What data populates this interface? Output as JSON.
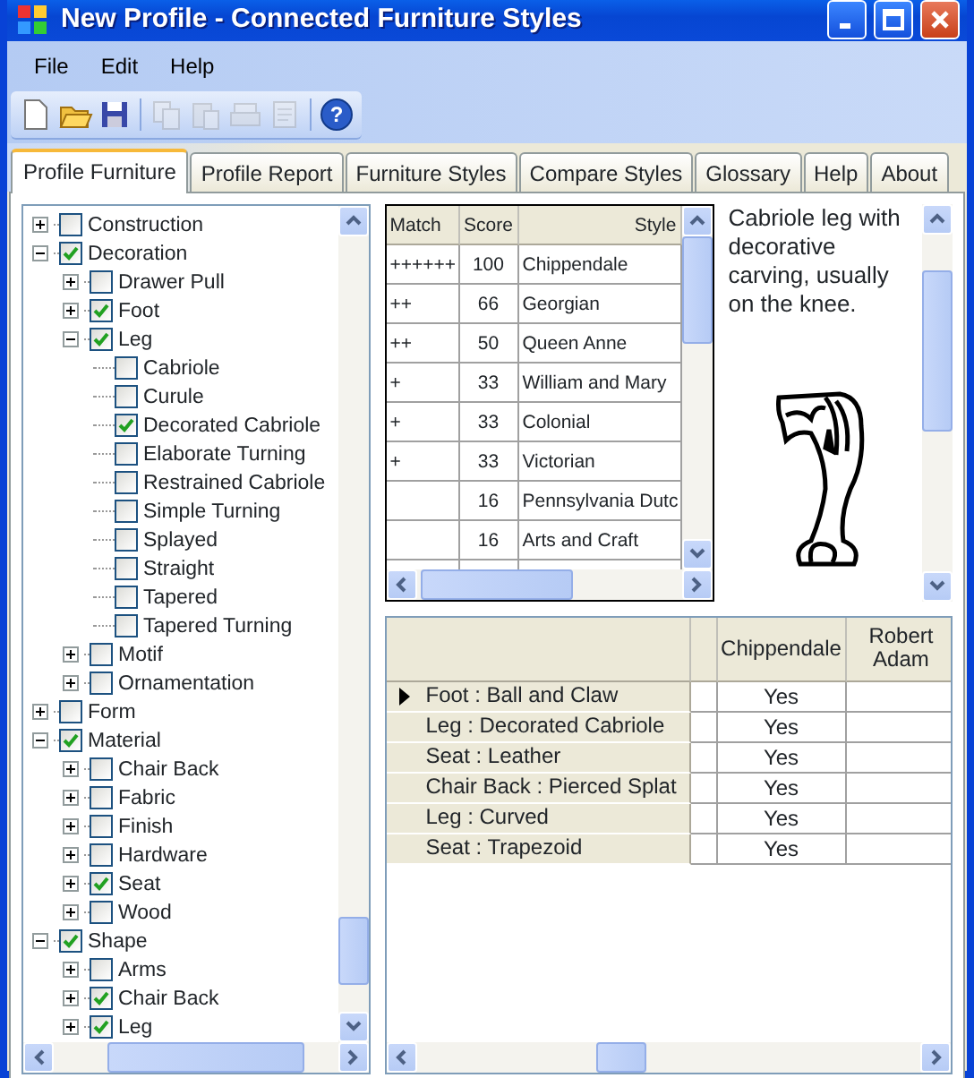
{
  "window": {
    "title": "New Profile - Connected Furniture Styles"
  },
  "menu": [
    "File",
    "Edit",
    "Help"
  ],
  "toolbar": [
    {
      "kind": "button",
      "disabled": false
    },
    {
      "kind": "button",
      "disabled": false
    },
    {
      "kind": "button",
      "disabled": false
    },
    {
      "kind": "separator"
    },
    {
      "kind": "button",
      "disabled": true
    },
    {
      "kind": "button",
      "disabled": true
    },
    {
      "kind": "button",
      "disabled": true
    },
    {
      "kind": "button",
      "disabled": true
    },
    {
      "kind": "separator"
    },
    {
      "kind": "button",
      "disabled": false,
      "label": "?"
    }
  ],
  "tabs": [
    {
      "label": "Profile Furniture",
      "selected": true
    },
    {
      "label": "Profile Report",
      "selected": false
    },
    {
      "label": "Furniture Styles",
      "selected": false
    },
    {
      "label": "Compare Styles",
      "selected": false
    },
    {
      "label": "Glossary",
      "selected": false
    },
    {
      "label": "Help",
      "selected": false
    },
    {
      "label": "About",
      "selected": false
    }
  ],
  "tree": [
    {
      "label": "Construction",
      "checked": false,
      "kind": "branch",
      "expanded": false
    },
    {
      "label": "Decoration",
      "checked": true,
      "kind": "branch",
      "expanded": true,
      "children": [
        {
          "label": "Drawer Pull",
          "checked": false,
          "kind": "branch",
          "expanded": false
        },
        {
          "label": "Foot",
          "checked": true,
          "kind": "branch",
          "expanded": false
        },
        {
          "label": "Leg",
          "checked": true,
          "kind": "branch",
          "expanded": true,
          "children": [
            {
              "label": "Cabriole",
              "checked": false,
              "kind": "leaf"
            },
            {
              "label": "Curule",
              "checked": false,
              "kind": "leaf"
            },
            {
              "label": "Decorated Cabriole",
              "checked": true,
              "kind": "leaf"
            },
            {
              "label": "Elaborate Turning",
              "checked": false,
              "kind": "leaf"
            },
            {
              "label": "Restrained Cabriole",
              "checked": false,
              "kind": "leaf"
            },
            {
              "label": "Simple Turning",
              "checked": false,
              "kind": "leaf"
            },
            {
              "label": "Splayed",
              "checked": false,
              "kind": "leaf"
            },
            {
              "label": "Straight",
              "checked": false,
              "kind": "leaf"
            },
            {
              "label": "Tapered",
              "checked": false,
              "kind": "leaf"
            },
            {
              "label": "Tapered Turning",
              "checked": false,
              "kind": "leaf"
            }
          ]
        },
        {
          "label": "Motif",
          "checked": false,
          "kind": "branch",
          "expanded": false
        },
        {
          "label": "Ornamentation",
          "checked": false,
          "kind": "branch",
          "expanded": false
        }
      ]
    },
    {
      "label": "Form",
      "checked": false,
      "kind": "branch",
      "expanded": false
    },
    {
      "label": "Material",
      "checked": true,
      "kind": "branch",
      "expanded": true,
      "children": [
        {
          "label": "Chair Back",
          "checked": false,
          "kind": "branch",
          "expanded": false
        },
        {
          "label": "Fabric",
          "checked": false,
          "kind": "branch",
          "expanded": false
        },
        {
          "label": "Finish",
          "checked": false,
          "kind": "branch",
          "expanded": false
        },
        {
          "label": "Hardware",
          "checked": false,
          "kind": "branch",
          "expanded": false
        },
        {
          "label": "Seat",
          "checked": true,
          "kind": "branch",
          "expanded": false
        },
        {
          "label": "Wood",
          "checked": false,
          "kind": "branch",
          "expanded": false
        }
      ]
    },
    {
      "label": "Shape",
      "checked": true,
      "kind": "branch",
      "expanded": true,
      "children": [
        {
          "label": "Arms",
          "checked": false,
          "kind": "branch",
          "expanded": false
        },
        {
          "label": "Chair Back",
          "checked": true,
          "kind": "branch",
          "expanded": false
        },
        {
          "label": "Leg",
          "checked": true,
          "kind": "branch",
          "expanded": false
        }
      ]
    }
  ],
  "matches": {
    "columns": [
      "Match",
      "Score",
      "Style"
    ],
    "rows": [
      {
        "match": "++++++",
        "score": "100",
        "style": "Chippendale"
      },
      {
        "match": "++",
        "score": "66",
        "style": "Georgian"
      },
      {
        "match": "++",
        "score": "50",
        "style": "Queen Anne"
      },
      {
        "match": "+",
        "score": "33",
        "style": "William and Mary"
      },
      {
        "match": "+",
        "score": "33",
        "style": "Colonial"
      },
      {
        "match": "+",
        "score": "33",
        "style": "Victorian"
      },
      {
        "score": "16",
        "style": "Pennsylvania Dutc"
      },
      {
        "score": "16",
        "style": "Arts and Craft"
      }
    ]
  },
  "description": "Cabriole leg with decorative carving, usually on the knee.",
  "compare": {
    "columns": [
      "Chippendale",
      "Robert Adam"
    ],
    "rows": [
      {
        "label": "Foot : Ball and Claw",
        "selected": true,
        "values": [
          "Yes"
        ]
      },
      {
        "label": "Leg : Decorated Cabriole",
        "selected": false,
        "values": [
          "Yes"
        ]
      },
      {
        "label": "Seat : Leather",
        "selected": false,
        "values": [
          "Yes"
        ]
      },
      {
        "label": "Chair Back : Pierced Splat",
        "selected": false,
        "values": [
          "Yes"
        ]
      },
      {
        "label": "Leg : Curved",
        "selected": false,
        "values": [
          "Yes"
        ]
      },
      {
        "label": "Seat : Trapezoid",
        "selected": false,
        "values": [
          "Yes"
        ]
      }
    ]
  }
}
